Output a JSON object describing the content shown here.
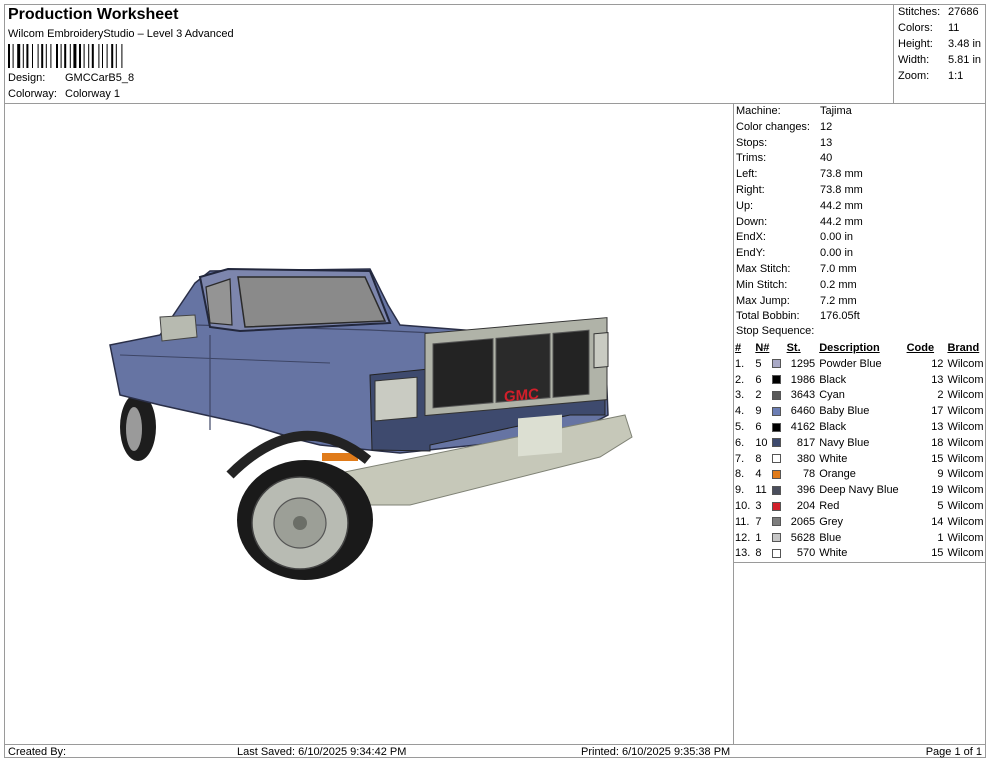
{
  "header": {
    "title": "Production Worksheet",
    "subtitle": "Wilcom EmbroideryStudio – Level 3 Advanced",
    "design_label": "Design:",
    "design_value": "GMCCarB5_8",
    "colorway_label": "Colorway:",
    "colorway_value": "Colorway 1"
  },
  "summary": [
    {
      "label": "Stitches:",
      "value": "27686"
    },
    {
      "label": "Colors:",
      "value": "11"
    },
    {
      "label": "Height:",
      "value": "3.48 in"
    },
    {
      "label": "Width:",
      "value": "5.81 in"
    },
    {
      "label": "Zoom:",
      "value": "1:1"
    }
  ],
  "specs": [
    {
      "label": "Machine:",
      "value": "Tajima"
    },
    {
      "label": "Color changes:",
      "value": "12"
    },
    {
      "label": "Stops:",
      "value": "13"
    },
    {
      "label": "Trims:",
      "value": "40"
    },
    {
      "label": "Left:",
      "value": "73.8 mm"
    },
    {
      "label": "Right:",
      "value": "73.8 mm"
    },
    {
      "label": "Up:",
      "value": "44.2 mm"
    },
    {
      "label": "Down:",
      "value": "44.2 mm"
    },
    {
      "label": "EndX:",
      "value": "0.00 in"
    },
    {
      "label": "EndY:",
      "value": "0.00 in"
    },
    {
      "label": "Max Stitch:",
      "value": "7.0 mm"
    },
    {
      "label": "Min Stitch:",
      "value": "0.2 mm"
    },
    {
      "label": "Max Jump:",
      "value": "7.2 mm"
    },
    {
      "label": "Total Bobbin:",
      "value": "176.05ft"
    }
  ],
  "stop_sequence": {
    "title": "Stop Sequence:",
    "headers": {
      "idx": "#",
      "n": "N#",
      "st": "St.",
      "desc": "Description",
      "code": "Code",
      "brand": "Brand"
    },
    "rows": [
      {
        "idx": "1.",
        "n": "5",
        "color": "#a9a9c6",
        "st": "1295",
        "desc": "Powder Blue",
        "code": "12",
        "brand": "Wilcom"
      },
      {
        "idx": "2.",
        "n": "6",
        "color": "#000000",
        "st": "1986",
        "desc": "Black",
        "code": "13",
        "brand": "Wilcom"
      },
      {
        "idx": "3.",
        "n": "2",
        "color": "#5a5a5a",
        "st": "3643",
        "desc": "Cyan",
        "code": "2",
        "brand": "Wilcom"
      },
      {
        "idx": "4.",
        "n": "9",
        "color": "#6c7eb4",
        "st": "6460",
        "desc": "Baby Blue",
        "code": "17",
        "brand": "Wilcom"
      },
      {
        "idx": "5.",
        "n": "6",
        "color": "#000000",
        "st": "4162",
        "desc": "Black",
        "code": "13",
        "brand": "Wilcom"
      },
      {
        "idx": "6.",
        "n": "10",
        "color": "#3e4a6e",
        "st": "817",
        "desc": "Navy Blue",
        "code": "18",
        "brand": "Wilcom"
      },
      {
        "idx": "7.",
        "n": "8",
        "color": "#ffffff",
        "st": "380",
        "desc": "White",
        "code": "15",
        "brand": "Wilcom"
      },
      {
        "idx": "8.",
        "n": "4",
        "color": "#e07b1a",
        "st": "78",
        "desc": "Orange",
        "code": "9",
        "brand": "Wilcom"
      },
      {
        "idx": "9.",
        "n": "11",
        "color": "#4a4e5c",
        "st": "396",
        "desc": "Deep Navy Blue",
        "code": "19",
        "brand": "Wilcom"
      },
      {
        "idx": "10.",
        "n": "3",
        "color": "#d11f2a",
        "st": "204",
        "desc": "Red",
        "code": "5",
        "brand": "Wilcom"
      },
      {
        "idx": "11.",
        "n": "7",
        "color": "#7d7d7d",
        "st": "2065",
        "desc": "Grey",
        "code": "14",
        "brand": "Wilcom"
      },
      {
        "idx": "12.",
        "n": "1",
        "color": "#c6c6c6",
        "st": "5628",
        "desc": "Blue",
        "code": "1",
        "brand": "Wilcom"
      },
      {
        "idx": "13.",
        "n": "8",
        "color": "#ffffff",
        "st": "570",
        "desc": "White",
        "code": "15",
        "brand": "Wilcom"
      }
    ]
  },
  "footer": {
    "created_by": "Created By:",
    "last_saved": "Last Saved: 6/10/2025 9:34:42 PM",
    "printed": "Printed: 6/10/2025 9:35:38 PM",
    "page": "Page 1 of 1"
  },
  "design": {
    "grille_logo": "GMC"
  }
}
